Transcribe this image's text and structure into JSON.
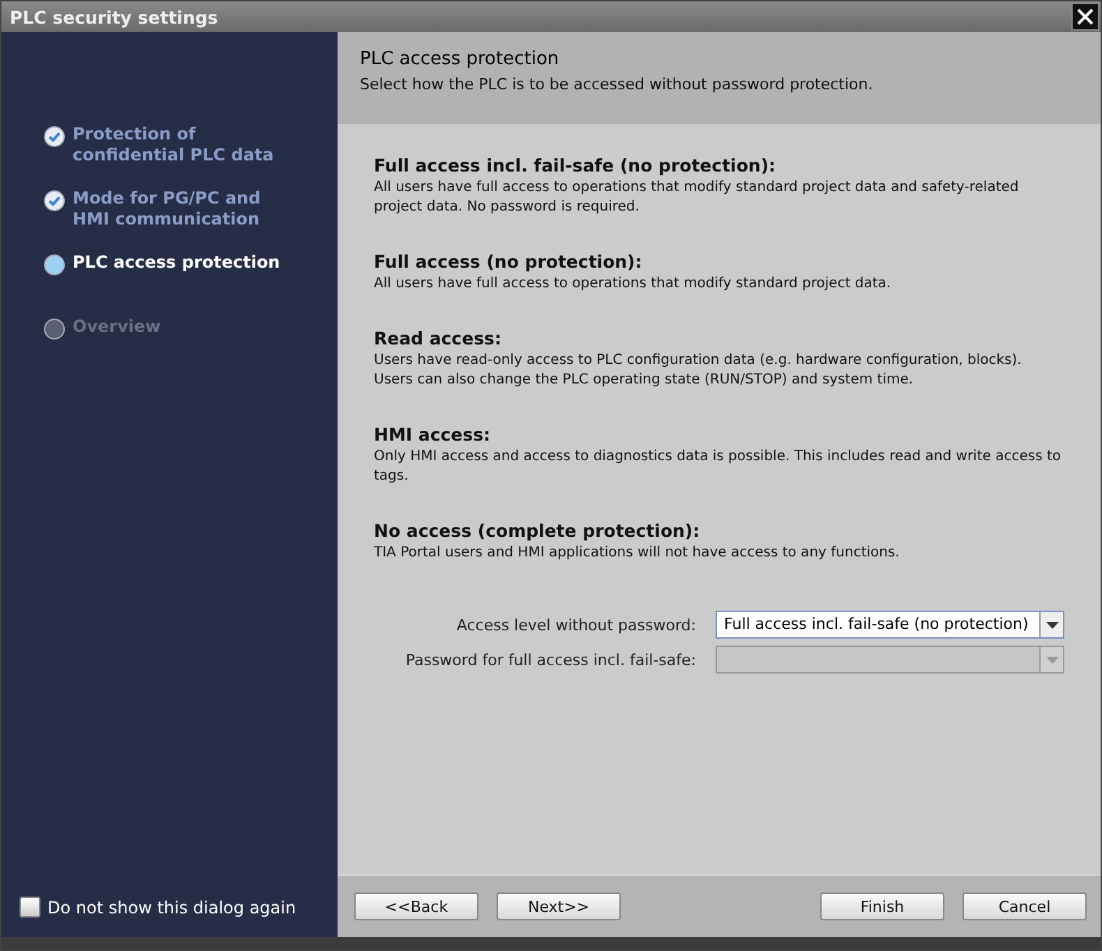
{
  "window": {
    "title": "PLC security settings"
  },
  "steps": [
    {
      "label": "Protection of confidential PLC data",
      "done": true,
      "selected": false
    },
    {
      "label": "Mode for PG/PC and HMI communication",
      "done": true,
      "selected": false
    },
    {
      "label": "PLC access protection",
      "done": false,
      "selected": true
    },
    {
      "label": "Overview",
      "done": false,
      "selected": false
    }
  ],
  "dont_show_again": {
    "label": "Do not show this dialog again",
    "checked": false
  },
  "header": {
    "title": "PLC access protection",
    "subtitle": "Select how the PLC is to be accessed without password protection."
  },
  "levels": [
    {
      "title": "Full access incl. fail-safe (no protection):",
      "text": "All users have full access to operations that modify standard project data and safety-related project data. No password is required."
    },
    {
      "title": "Full access (no protection):",
      "text": "All users have full access to operations that modify standard project data."
    },
    {
      "title": "Read access:",
      "text": "Users have read-only access to PLC configuration data (e.g. hardware configuration, blocks). Users can also change the PLC operating state (RUN/STOP) and system time."
    },
    {
      "title": "HMI access:",
      "text": "Only HMI access and access to diagnostics data is possible. This includes read and write access to tags."
    },
    {
      "title": "No access (complete protection):",
      "text": "TIA Portal users and HMI applications will not have access to any functions."
    }
  ],
  "fields": [
    {
      "label": "Access level without password:",
      "value": "Full access incl. fail-safe (no protection)",
      "disabled": false
    },
    {
      "label": "Password for full access incl. fail-safe:",
      "disabled": true
    }
  ],
  "buttons": {
    "left": [
      "<<Back",
      "Next>>"
    ],
    "right": [
      "Finish",
      "Cancel"
    ]
  }
}
